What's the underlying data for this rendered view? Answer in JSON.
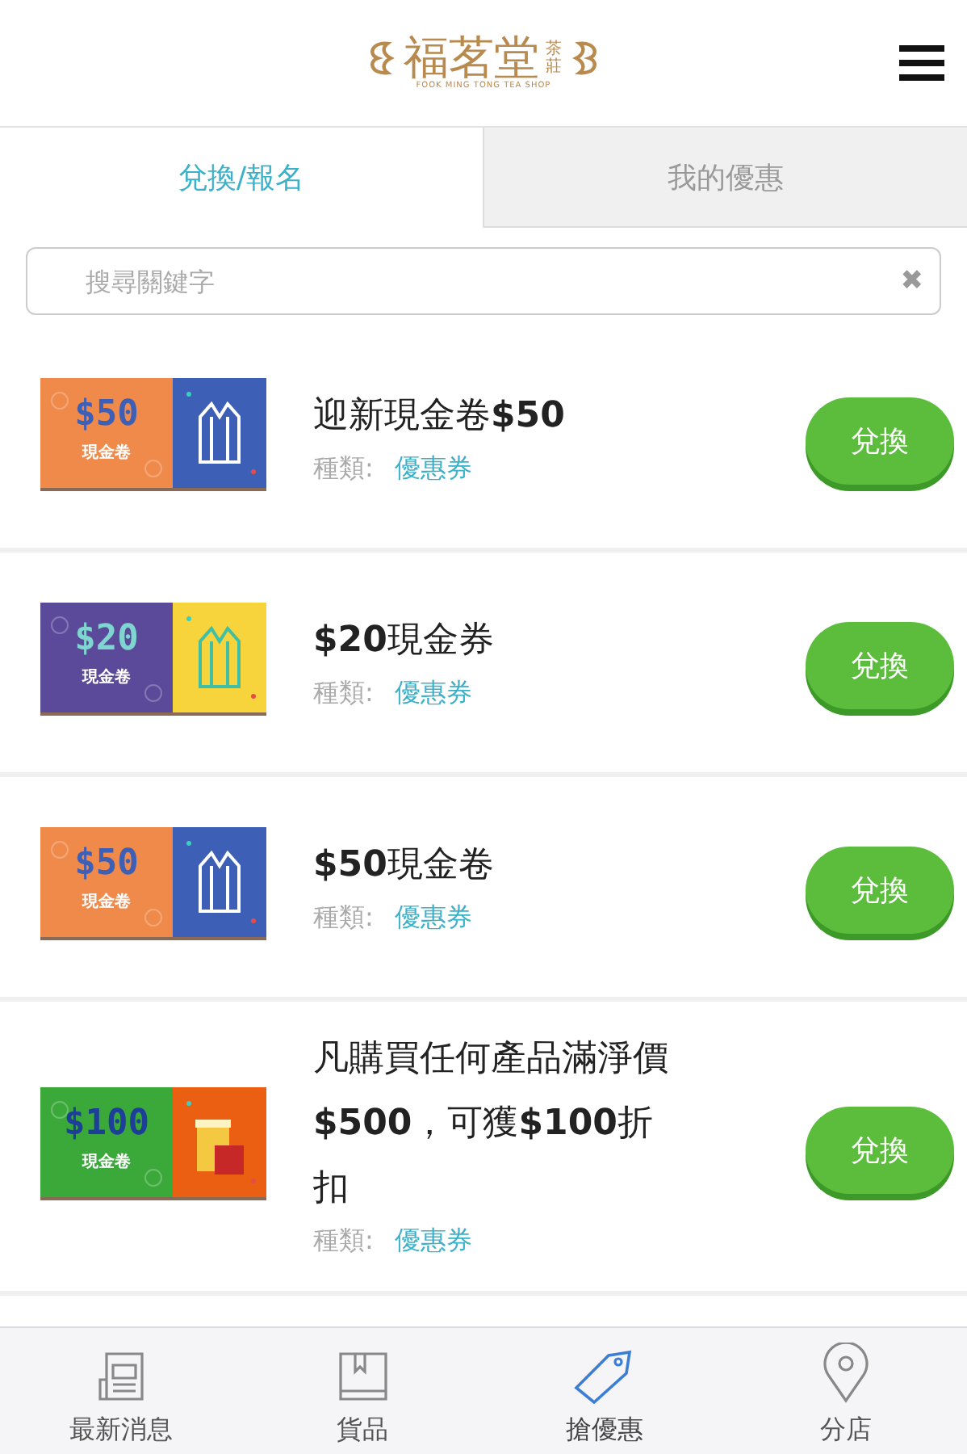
{
  "header": {
    "logo_name": "福茗堂",
    "logo_suffix": "茶莊",
    "logo_subtitle": "FOOK MING TONG TEA SHOP"
  },
  "tabs": [
    {
      "label": "兌換/報名",
      "selected": true
    },
    {
      "label": "我的優惠",
      "selected": false
    }
  ],
  "search": {
    "placeholder": "搜尋關鍵字",
    "clear": "✖"
  },
  "coupons": [
    {
      "image": {
        "kind": "orange-blue",
        "amount": "$50",
        "label": "現金卷"
      },
      "title": "迎新現金卷**$50**",
      "type_label": "種類:",
      "type": "優惠券",
      "button": "兌換"
    },
    {
      "image": {
        "kind": "purple-yellow",
        "amount": "$20",
        "label": "現金卷"
      },
      "title": "**$20**現金券",
      "type_label": "種類:",
      "type": "優惠券",
      "button": "兌換"
    },
    {
      "image": {
        "kind": "orange-blue",
        "amount": "$50",
        "label": "現金卷"
      },
      "title": "**$50**現金卷",
      "type_label": "種類:",
      "type": "優惠券",
      "button": "兌換"
    },
    {
      "image": {
        "kind": "green-orange",
        "amount": "$100",
        "label": "現金卷"
      },
      "title": "凡購買任何產品滿淨價**$500**，可獲**$100**折扣",
      "type_label": "種類:",
      "type": "優惠券",
      "button": "兌換"
    }
  ],
  "bottom_nav": [
    {
      "kind": "news",
      "label": "最新消息",
      "selected": false
    },
    {
      "kind": "book",
      "label": "貨品",
      "selected": false
    },
    {
      "kind": "tag",
      "label": "搶優惠",
      "selected": true
    },
    {
      "kind": "pin",
      "label": "分店",
      "selected": false
    }
  ]
}
